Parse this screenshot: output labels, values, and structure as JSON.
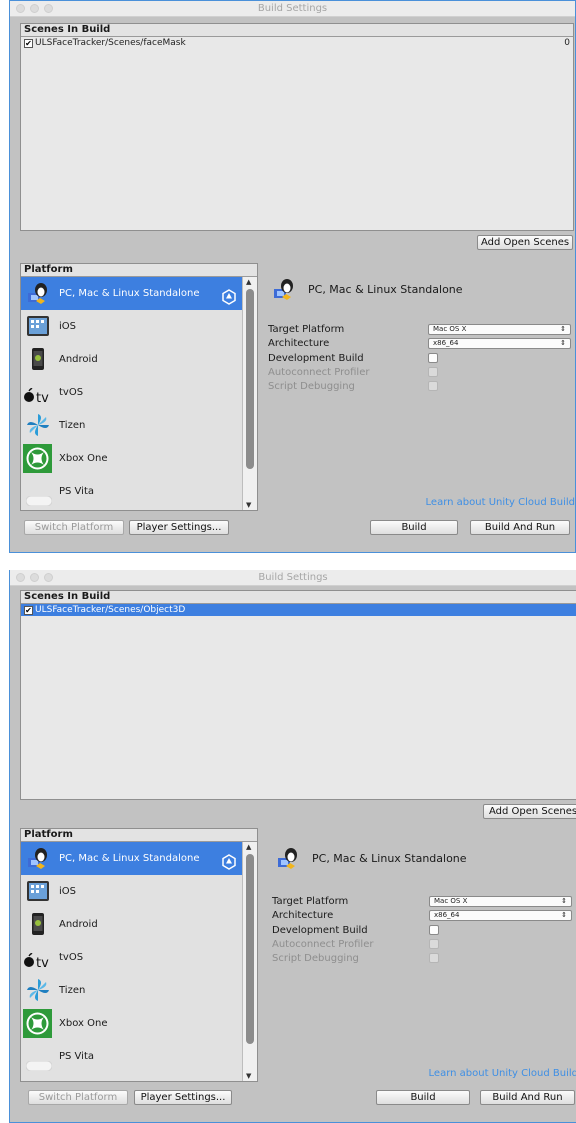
{
  "window": {
    "title": "Build Settings"
  },
  "top": {
    "scenes_header": "Scenes In Build",
    "scenes": [
      {
        "path": "ULSFaceTracker/Scenes/faceMask",
        "index": "0",
        "checked": true,
        "selected": false
      }
    ]
  },
  "bottom": {
    "scenes_header": "Scenes In Build",
    "scenes": [
      {
        "path": "ULSFaceTracker/Scenes/Object3D",
        "index": "0",
        "checked": true,
        "selected": true
      }
    ]
  },
  "add_open_scenes": "Add Open Scenes",
  "platform": {
    "header": "Platform",
    "items": [
      {
        "label": "PC, Mac & Linux Standalone",
        "icon": "standalone-icon",
        "selected": true
      },
      {
        "label": "iOS",
        "icon": "ios-icon",
        "selected": false
      },
      {
        "label": "Android",
        "icon": "android-icon",
        "selected": false
      },
      {
        "label": "tvOS",
        "icon": "appletv-icon",
        "selected": false
      },
      {
        "label": "Tizen",
        "icon": "tizen-icon",
        "selected": false
      },
      {
        "label": "Xbox One",
        "icon": "xbox-icon",
        "selected": false
      },
      {
        "label": "PS Vita",
        "icon": "psvita-icon",
        "selected": false
      }
    ]
  },
  "settings": {
    "title": "PC, Mac & Linux Standalone",
    "target_platform_label": "Target Platform",
    "target_platform_value": "Mac OS X",
    "architecture_label": "Architecture",
    "architecture_value": "x86_64",
    "development_build_label": "Development Build",
    "autoconnect_profiler_label": "Autoconnect Profiler",
    "script_debugging_label": "Script Debugging",
    "cloud_link": "Learn about Unity Cloud Build"
  },
  "buttons": {
    "switch_platform": "Switch Platform",
    "player_settings": "Player Settings...",
    "build": "Build",
    "build_and_run": "Build And Run"
  },
  "colors": {
    "selection": "#3d7fe0",
    "window_bg": "#c2c2c2",
    "link": "#3f8fe4",
    "focus_border": "#4a90d9"
  }
}
